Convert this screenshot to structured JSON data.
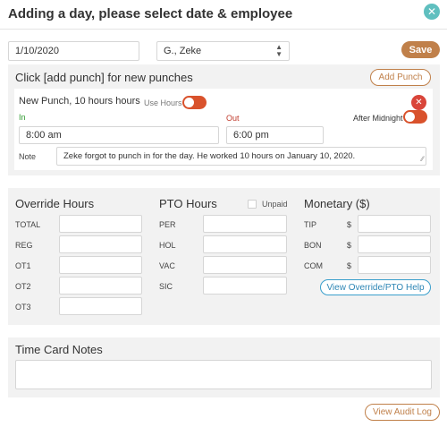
{
  "header": {
    "title": "Adding a day, please select date & employee",
    "close_icon": "✕"
  },
  "top_bar": {
    "date_value": "1/10/2020",
    "employee_value": "G., Zeke",
    "save_label": "Save"
  },
  "punch_section": {
    "heading": "Click [add punch] for new punches",
    "add_punch_label": "Add Punch",
    "punch": {
      "title": "New Punch, 10 hours hours",
      "use_hours_label": "Use Hours",
      "in_label": "In",
      "out_label": "Out",
      "after_midnight_label": "After Midnight",
      "in_time": "8:00 am",
      "out_time": "6:00 pm",
      "note_label": "Note",
      "note_text": "Zeke forgot to punch in for the day. He worked 10 hours on January 10, 2020."
    }
  },
  "override": {
    "heading": "Override Hours",
    "rows": [
      "TOTAL",
      "REG",
      "OT1",
      "OT2",
      "OT3"
    ]
  },
  "pto": {
    "heading": "PTO Hours",
    "unpaid_label": "Unpaid",
    "rows": [
      "PER",
      "HOL",
      "VAC",
      "SIC"
    ]
  },
  "monetary": {
    "heading": "Monetary ($)",
    "currency_symbol": "$",
    "rows": [
      "TIP",
      "BON",
      "COM"
    ],
    "help_label": "View Override/PTO Help"
  },
  "notes": {
    "heading": "Time Card Notes"
  },
  "footer": {
    "audit_label": "View Audit Log"
  },
  "colors": {
    "accent_brown": "#c0804a",
    "toggle_red": "#d9522c",
    "remove_red": "#d9453a",
    "close_teal": "#5fbfbf",
    "in_green": "#2f9a2f",
    "out_red": "#c0392b",
    "help_blue": "#3a9fcc"
  }
}
